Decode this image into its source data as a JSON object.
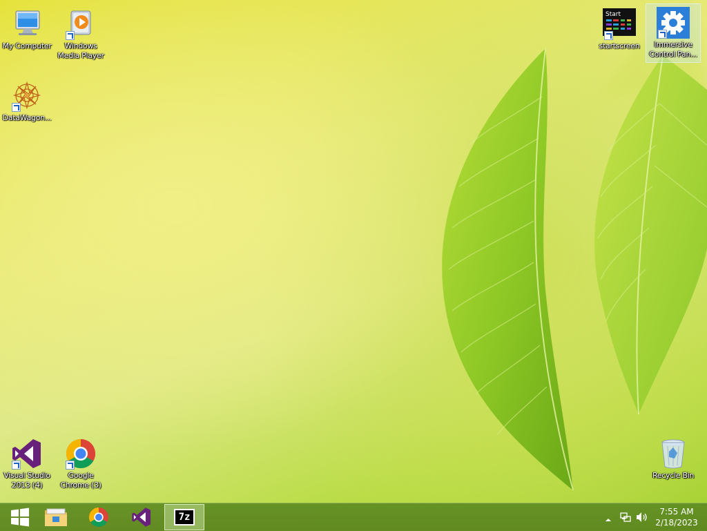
{
  "desktop": {
    "icons": [
      {
        "label": "My Computer",
        "icon": "computer-icon"
      },
      {
        "label": "Windows Media Player",
        "icon": "media-player-icon"
      },
      {
        "label": "DataWagon...",
        "icon": "datawagon-icon"
      },
      {
        "label": "startscreen",
        "icon": "startscreen-icon",
        "tile_text": "Start"
      },
      {
        "label": "Immersive Control Pan...",
        "icon": "gear-icon"
      },
      {
        "label": "Visual Studio 2013 (4)",
        "icon": "visual-studio-icon"
      },
      {
        "label": "Google Chrome (3)",
        "icon": "chrome-icon"
      },
      {
        "label": "Recycle Bin",
        "icon": "recycle-bin-icon"
      }
    ]
  },
  "taskbar": {
    "items": [
      {
        "icon": "windows-start-icon"
      },
      {
        "icon": "file-explorer-icon"
      },
      {
        "icon": "chrome-icon"
      },
      {
        "icon": "visual-studio-icon"
      },
      {
        "icon": "7zip-icon",
        "label": "7z",
        "active": true
      }
    ],
    "tray": {
      "icons": [
        "tray-arrow-icon",
        "network-icon",
        "volume-icon"
      ],
      "time": "7:55 AM",
      "date": "2/18/2023"
    }
  },
  "colors": {
    "vs_purple": "#68217a",
    "taskbar": "#5f8c23",
    "gear_bg": "#2c7fd8"
  }
}
